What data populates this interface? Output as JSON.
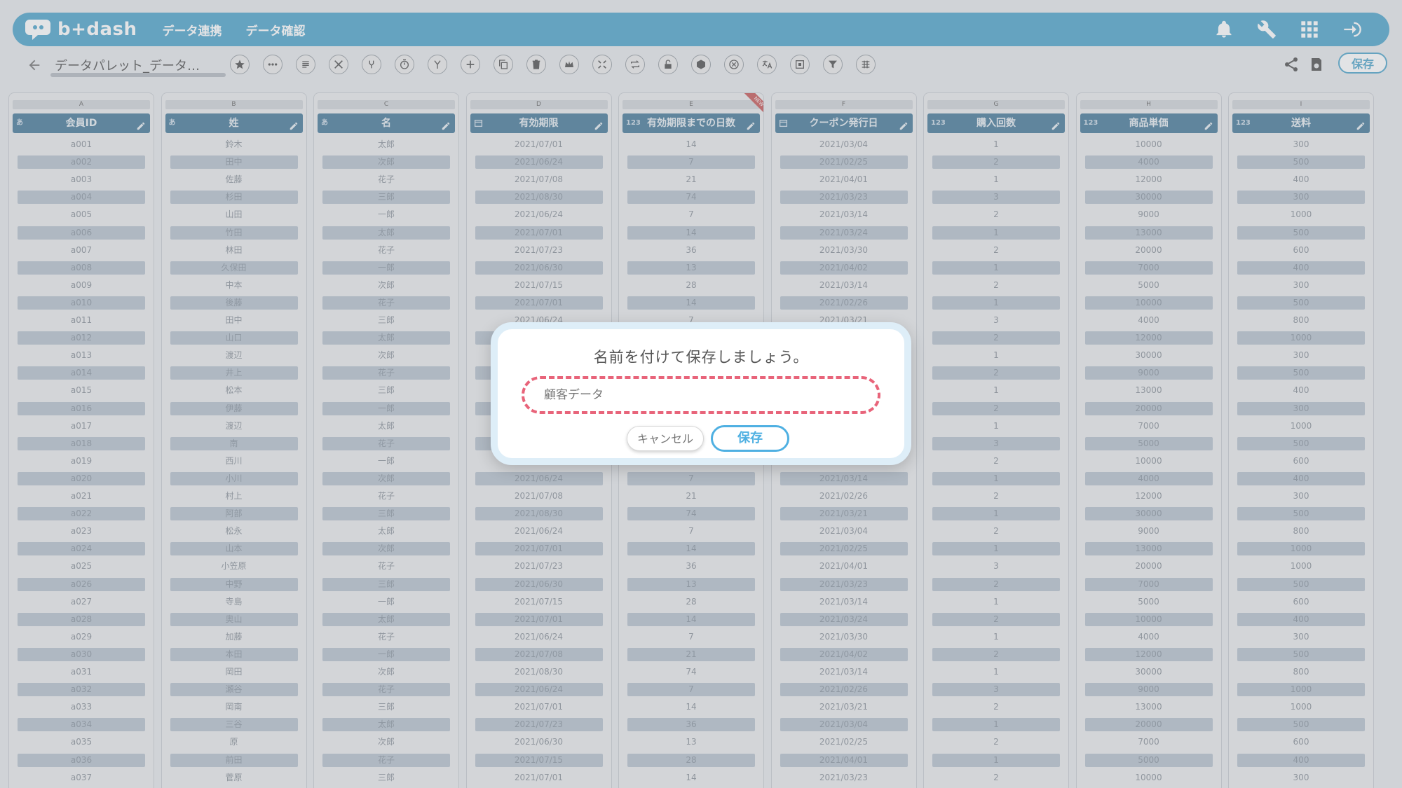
{
  "app": {
    "logo_text": "b+dash",
    "nav": [
      "データ連携",
      "データ確認"
    ]
  },
  "toolbar": {
    "palette_name": "データパレット_データ…",
    "save_label": "保存"
  },
  "colors": {
    "brand": "#53a7cc",
    "header": "#4c7d9c",
    "dialog_input_border": "#e8647a",
    "dialog_save": "#4fb0e2"
  },
  "table": {
    "columns": [
      {
        "letter": "A",
        "name": "会員ID",
        "type": "あ"
      },
      {
        "letter": "B",
        "name": "姓",
        "type": "あ"
      },
      {
        "letter": "C",
        "name": "名",
        "type": "あ"
      },
      {
        "letter": "D",
        "name": "有効期限",
        "type": "date"
      },
      {
        "letter": "E",
        "name": "有効期限までの日数",
        "type": "123",
        "badge": "NEW"
      },
      {
        "letter": "F",
        "name": "クーポン発行日",
        "type": "date"
      },
      {
        "letter": "G",
        "name": "購入回数",
        "type": "123"
      },
      {
        "letter": "H",
        "name": "商品単価",
        "type": "123"
      },
      {
        "letter": "I",
        "name": "送料",
        "type": "123"
      }
    ],
    "rows": [
      [
        "a001",
        "鈴木",
        "太郎",
        "2021/07/01",
        "14",
        "2021/03/04",
        "1",
        "10000",
        "300"
      ],
      [
        "a002",
        "田中",
        "次郎",
        "2021/06/24",
        "7",
        "2021/02/25",
        "2",
        "4000",
        "500"
      ],
      [
        "a003",
        "佐藤",
        "花子",
        "2021/07/08",
        "21",
        "2021/04/01",
        "1",
        "12000",
        "400"
      ],
      [
        "a004",
        "杉田",
        "三郎",
        "2021/08/30",
        "74",
        "2021/03/23",
        "3",
        "30000",
        "300"
      ],
      [
        "a005",
        "山田",
        "一郎",
        "2021/06/24",
        "7",
        "2021/03/14",
        "2",
        "9000",
        "1000"
      ],
      [
        "a006",
        "竹田",
        "太郎",
        "2021/07/01",
        "14",
        "2021/03/24",
        "1",
        "13000",
        "500"
      ],
      [
        "a007",
        "林田",
        "花子",
        "2021/07/23",
        "36",
        "2021/03/30",
        "2",
        "20000",
        "600"
      ],
      [
        "a008",
        "久保田",
        "一郎",
        "2021/06/30",
        "13",
        "2021/04/02",
        "1",
        "7000",
        "400"
      ],
      [
        "a009",
        "中本",
        "次郎",
        "2021/07/15",
        "28",
        "2021/03/14",
        "2",
        "5000",
        "300"
      ],
      [
        "a010",
        "後藤",
        "花子",
        "2021/07/01",
        "14",
        "2021/02/26",
        "1",
        "10000",
        "500"
      ],
      [
        "a011",
        "田中",
        "三郎",
        "2021/06/24",
        "7",
        "2021/03/21",
        "3",
        "4000",
        "800"
      ],
      [
        "a012",
        "山口",
        "太郎",
        "",
        "",
        "",
        "2",
        "12000",
        "1000"
      ],
      [
        "a013",
        "渡辺",
        "次郎",
        "",
        "",
        "",
        "1",
        "30000",
        "300"
      ],
      [
        "a014",
        "井上",
        "花子",
        "",
        "",
        "",
        "2",
        "9000",
        "500"
      ],
      [
        "a015",
        "松本",
        "三郎",
        "",
        "",
        "",
        "1",
        "13000",
        "400"
      ],
      [
        "a016",
        "伊藤",
        "一郎",
        "",
        "",
        "",
        "2",
        "20000",
        "300"
      ],
      [
        "a017",
        "渡辺",
        "太郎",
        "",
        "",
        "",
        "1",
        "7000",
        "1000"
      ],
      [
        "a018",
        "南",
        "花子",
        "",
        "",
        "",
        "3",
        "5000",
        "500"
      ],
      [
        "a019",
        "西川",
        "一郎",
        "",
        "",
        "",
        "2",
        "10000",
        "600"
      ],
      [
        "a020",
        "小川",
        "次郎",
        "2021/06/24",
        "7",
        "2021/03/14",
        "1",
        "4000",
        "400"
      ],
      [
        "a021",
        "村上",
        "花子",
        "2021/07/08",
        "21",
        "2021/02/26",
        "2",
        "12000",
        "300"
      ],
      [
        "a022",
        "阿部",
        "三郎",
        "2021/08/30",
        "74",
        "2021/03/21",
        "1",
        "30000",
        "500"
      ],
      [
        "a023",
        "松永",
        "太郎",
        "2021/06/24",
        "7",
        "2021/03/04",
        "2",
        "9000",
        "800"
      ],
      [
        "a024",
        "山本",
        "次郎",
        "2021/07/01",
        "14",
        "2021/02/25",
        "1",
        "13000",
        "1000"
      ],
      [
        "a025",
        "小笠原",
        "花子",
        "2021/07/23",
        "36",
        "2021/04/01",
        "3",
        "20000",
        "1000"
      ],
      [
        "a026",
        "中野",
        "三郎",
        "2021/06/30",
        "13",
        "2021/03/23",
        "2",
        "7000",
        "500"
      ],
      [
        "a027",
        "寺島",
        "一郎",
        "2021/07/15",
        "28",
        "2021/03/14",
        "1",
        "5000",
        "600"
      ],
      [
        "a028",
        "奥山",
        "太郎",
        "2021/07/01",
        "14",
        "2021/03/24",
        "2",
        "10000",
        "400"
      ],
      [
        "a029",
        "加藤",
        "花子",
        "2021/06/24",
        "7",
        "2021/03/30",
        "1",
        "4000",
        "300"
      ],
      [
        "a030",
        "本田",
        "一郎",
        "2021/07/08",
        "21",
        "2021/04/02",
        "2",
        "12000",
        "500"
      ],
      [
        "a031",
        "岡田",
        "次郎",
        "2021/08/30",
        "74",
        "2021/03/14",
        "1",
        "30000",
        "800"
      ],
      [
        "a032",
        "瀬谷",
        "花子",
        "2021/06/24",
        "7",
        "2021/02/26",
        "3",
        "9000",
        "1000"
      ],
      [
        "a033",
        "岡南",
        "三郎",
        "2021/07/01",
        "14",
        "2021/03/21",
        "2",
        "13000",
        "1000"
      ],
      [
        "a034",
        "三谷",
        "太郎",
        "2021/07/23",
        "36",
        "2021/03/04",
        "1",
        "20000",
        "500"
      ],
      [
        "a035",
        "原",
        "次郎",
        "2021/06/30",
        "13",
        "2021/02/25",
        "2",
        "7000",
        "600"
      ],
      [
        "a036",
        "前田",
        "花子",
        "2021/07/15",
        "28",
        "2021/04/01",
        "1",
        "5000",
        "400"
      ],
      [
        "a037",
        "菅原",
        "三郎",
        "2021/07/01",
        "14",
        "2021/03/23",
        "2",
        "10000",
        "300"
      ]
    ]
  },
  "dialog": {
    "title": "名前を付けて保存しましょう。",
    "input_value": "顧客データ",
    "cancel_label": "キャンセル",
    "save_label": "保存"
  }
}
